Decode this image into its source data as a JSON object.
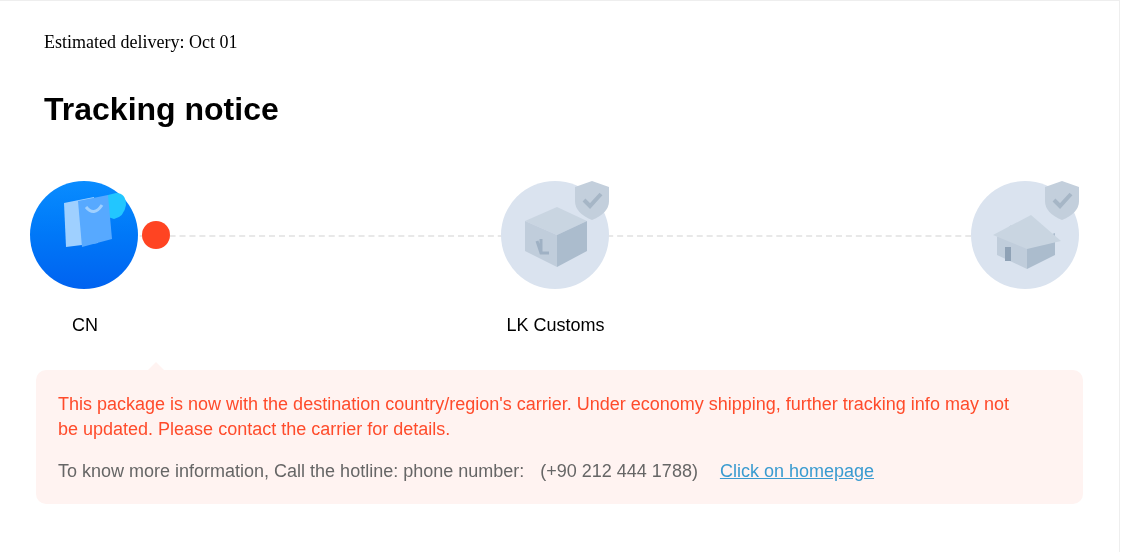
{
  "estimated_delivery": "Estimated delivery: Oct 01",
  "title": "Tracking notice",
  "steps": [
    {
      "kind": "bag",
      "active": true,
      "current": true,
      "label": "CN"
    },
    {
      "kind": "box",
      "active": false,
      "current": false,
      "label": "LK Customs"
    },
    {
      "kind": "house",
      "active": false,
      "current": false
    }
  ],
  "notice": {
    "message": "This package is now with the destination country/region's carrier. Under economy shipping, further tracking info may not be updated. Please contact the carrier for details.",
    "hotline": "To know more information, Call the hotline: phone number:",
    "phone": "(+90 212 444 1788)",
    "link": "Click on homepage"
  }
}
